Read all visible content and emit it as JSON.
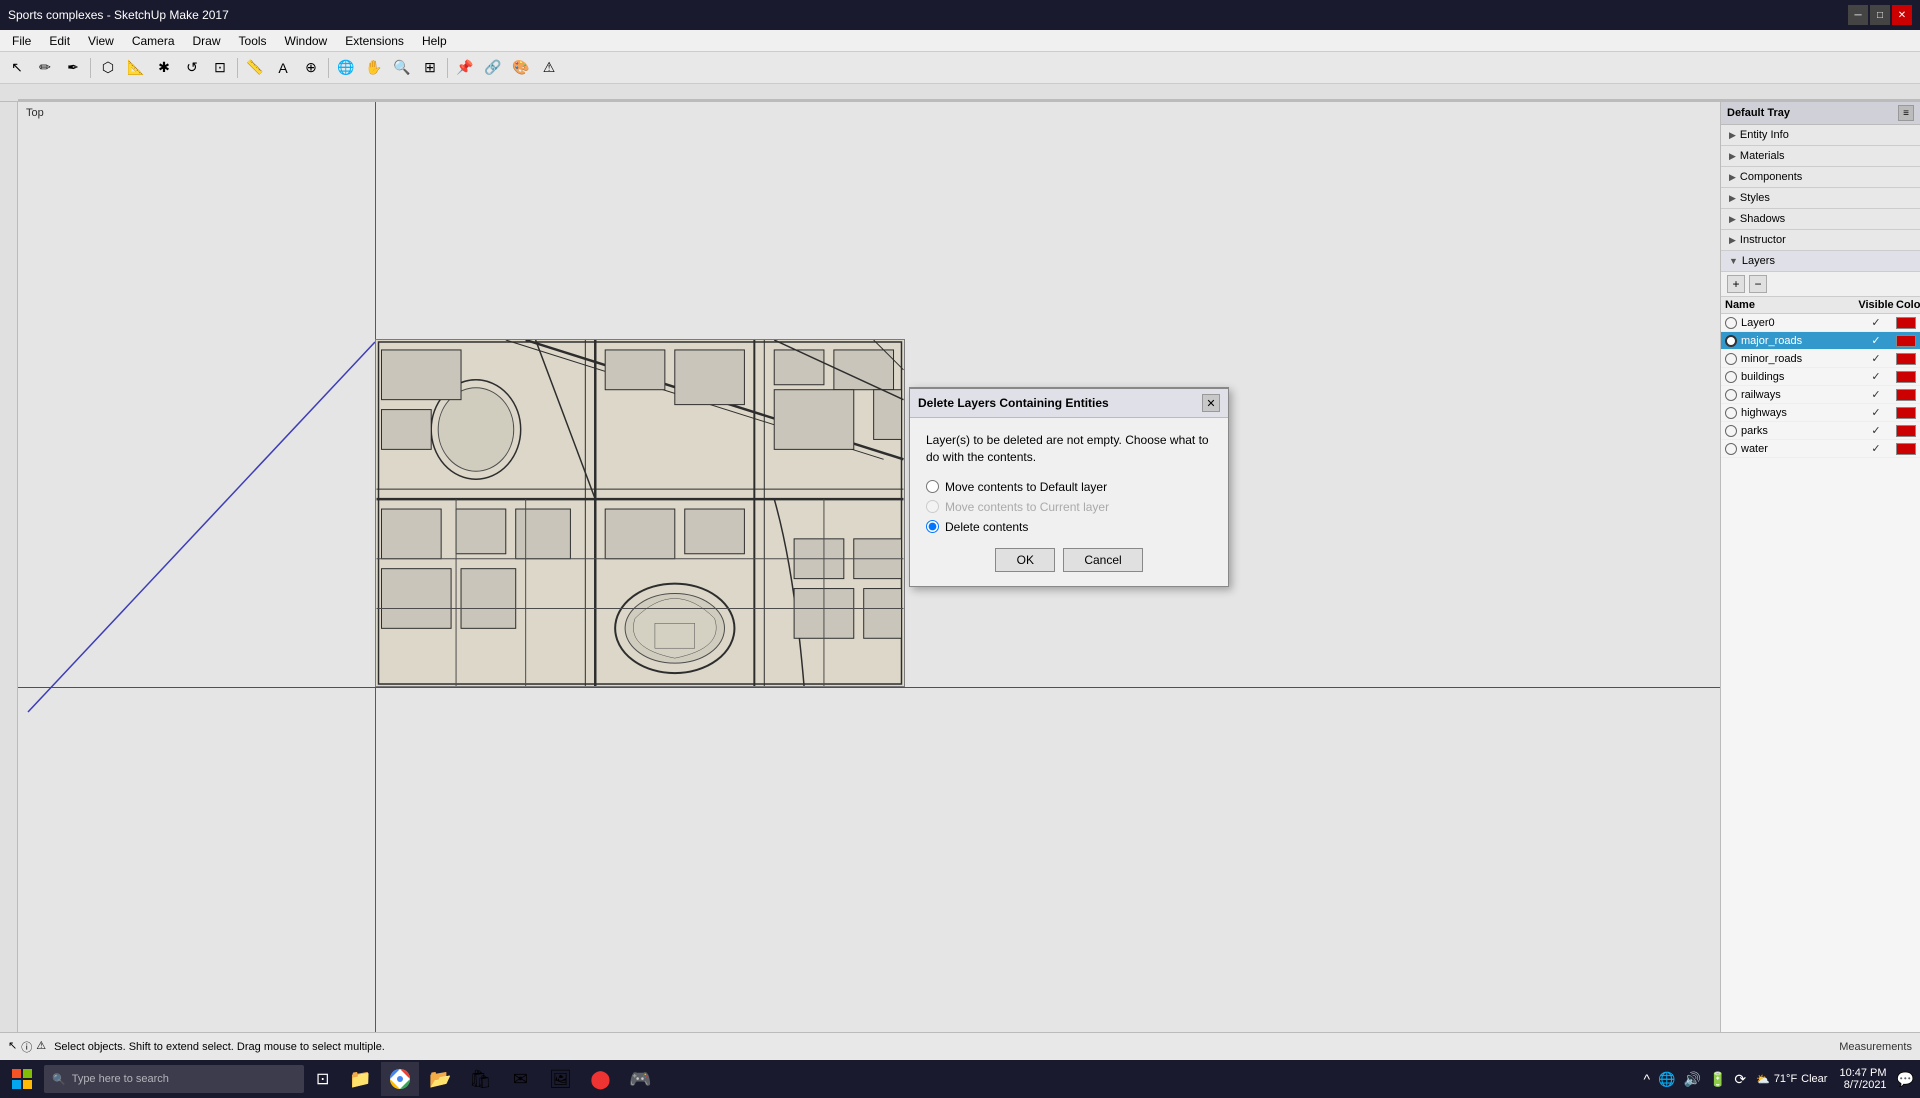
{
  "titlebar": {
    "title": "Sports complexes - SketchUp Make 2017",
    "min_label": "─",
    "max_label": "□",
    "close_label": "✕"
  },
  "menubar": {
    "items": [
      "File",
      "Edit",
      "View",
      "Camera",
      "Draw",
      "Tools",
      "Window",
      "Extensions",
      "Help"
    ]
  },
  "toolbar": {
    "tools": [
      "↖",
      "✏",
      "✒",
      "⬡",
      "📄",
      "🔴",
      "✱",
      "↺",
      "📋",
      "📌",
      "A",
      "🎨",
      "🚶",
      "👁",
      "🔍",
      "✂",
      "📌",
      "🔗",
      "📤",
      "⚠"
    ]
  },
  "view": {
    "label": "Top"
  },
  "statusbar": {
    "text": "Select objects. Shift to extend select. Drag mouse to select multiple.",
    "measurements": "Measurements"
  },
  "rightpanel": {
    "title": "Default Tray",
    "sections": [
      {
        "label": "Entity Info",
        "expanded": false
      },
      {
        "label": "Materials",
        "expanded": false
      },
      {
        "label": "Components",
        "expanded": false
      },
      {
        "label": "Styles",
        "expanded": false
      },
      {
        "label": "Shadows",
        "expanded": false
      },
      {
        "label": "Instructor",
        "expanded": false
      }
    ],
    "layers": {
      "title": "Layers",
      "columns": {
        "name": "Name",
        "visible": "Visible",
        "color": "Color"
      },
      "items": [
        {
          "name": "Layer0",
          "visible": true,
          "color": "#cc0000",
          "active": false,
          "selected": false
        },
        {
          "name": "major_roads",
          "visible": true,
          "color": "#cc0000",
          "active": true,
          "selected": true
        },
        {
          "name": "minor_roads",
          "visible": true,
          "color": "#cc0000",
          "active": false,
          "selected": false
        },
        {
          "name": "buildings",
          "visible": true,
          "color": "#cc0000",
          "active": false,
          "selected": false
        },
        {
          "name": "railways",
          "visible": true,
          "color": "#cc0000",
          "active": false,
          "selected": false
        },
        {
          "name": "highways",
          "visible": true,
          "color": "#cc0000",
          "active": false,
          "selected": false
        },
        {
          "name": "parks",
          "visible": true,
          "color": "#cc0000",
          "active": false,
          "selected": false
        },
        {
          "name": "water",
          "visible": true,
          "color": "#cc0000",
          "active": false,
          "selected": false
        }
      ]
    }
  },
  "modal": {
    "title": "Delete Layers Containing Entities",
    "description": "Layer(s) to be deleted are not empty.  Choose what to do with the contents.",
    "options": [
      {
        "id": "opt1",
        "label": "Move contents to Default layer",
        "checked": false,
        "disabled": false
      },
      {
        "id": "opt2",
        "label": "Move contents to Current layer",
        "checked": false,
        "disabled": true
      },
      {
        "id": "opt3",
        "label": "Delete contents",
        "checked": true,
        "disabled": false
      }
    ],
    "ok_label": "OK",
    "cancel_label": "Cancel"
  },
  "taskbar": {
    "search_placeholder": "Type here to search",
    "apps": [
      "⊞",
      "🔍",
      "🗔",
      "📁",
      "🌐",
      "📁",
      "📌",
      "📊",
      "🔴",
      "🎮"
    ],
    "right": {
      "weather": "71°F",
      "condition": "Clear",
      "time": "10:47 PM",
      "date": "8/7/2021"
    }
  }
}
